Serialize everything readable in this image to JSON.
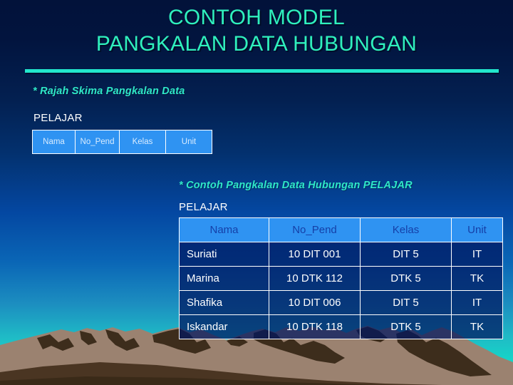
{
  "slide": {
    "title": "CONTOH MODEL\nPANGKALAN DATA HUBUNGAN",
    "accent_color": "#2ff0bd",
    "rule_color": "#22e6cc",
    "background_top_color": "#02123a",
    "background_bottom_color": "#0cf0cf",
    "mountain_light_color": "#9b8270",
    "mountain_dark_color": "#3d2d1c"
  },
  "schema_section": {
    "caption": "* Rajah Skima Pangkalan Data",
    "entity_label": "PELAJAR",
    "columns": [
      "Nama",
      "No_Pend",
      "Kelas",
      "Unit"
    ],
    "cell_bg_color": "#2f93f2",
    "cell_text_color": "#d8ecff"
  },
  "instance_section": {
    "caption": "* Contoh Pangkalan Data Hubungan PELAJAR",
    "entity_label": "PELAJAR",
    "header_bg_color": "#2f93f2",
    "header_text_color": "#1540a8",
    "row_text_color": "#ffffff",
    "columns": [
      "Nama",
      "No_Pend",
      "Kelas",
      "Unit"
    ],
    "rows": [
      {
        "nama": "Suriati",
        "no_pend": "10 DIT 001",
        "kelas": "DIT 5",
        "unit": "IT"
      },
      {
        "nama": "Marina",
        "no_pend": "10 DTK 112",
        "kelas": "DTK 5",
        "unit": "TK"
      },
      {
        "nama": "Shafika",
        "no_pend": "10 DIT 006",
        "kelas": "DIT 5",
        "unit": "IT"
      },
      {
        "nama": "Iskandar",
        "no_pend": "10 DTK 118",
        "kelas": "DTK 5",
        "unit": "TK"
      }
    ]
  }
}
